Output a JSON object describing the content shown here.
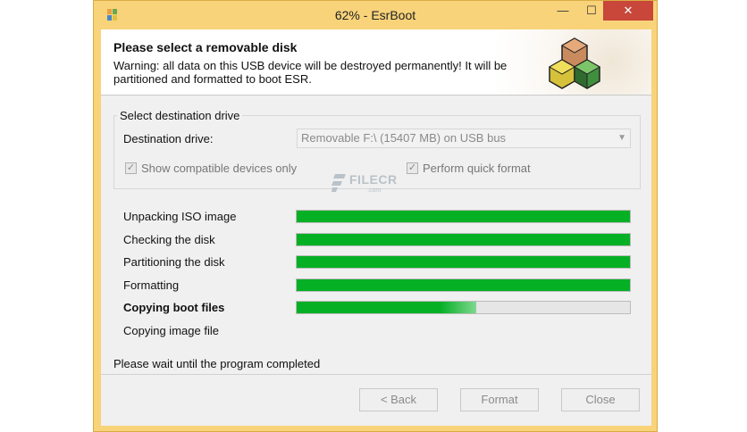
{
  "window": {
    "title": "62% - EsrBoot",
    "minimize_glyph": "—",
    "maximize_glyph": "☐",
    "close_glyph": "✕",
    "close_color": "#c8463a",
    "frame_color": "#f8d37a"
  },
  "header": {
    "title": "Please select a removable disk",
    "warning": "Warning: all data on this USB device will be destroyed permanently! It will be partitioned and formatted to boot ESR."
  },
  "destination": {
    "group_title": "Select destination drive",
    "drive_label": "Destination drive:",
    "drive_value": "Removable  F:\\  (15407 MB)  on USB bus",
    "show_compatible_label": "Show compatible devices only",
    "show_compatible_checked": true,
    "quick_format_label": "Perform quick format",
    "quick_format_checked": true
  },
  "watermark": {
    "text": "FILECR",
    "suffix": ".com"
  },
  "steps": [
    {
      "label": "Unpacking ISO image",
      "progress": 1.0,
      "bold": false
    },
    {
      "label": "Checking the disk",
      "progress": 1.0,
      "bold": false
    },
    {
      "label": "Partitioning the disk",
      "progress": 1.0,
      "bold": false
    },
    {
      "label": "Formatting",
      "progress": 1.0,
      "bold": false
    },
    {
      "label": "Copying boot files",
      "progress": 0.54,
      "bold": true
    },
    {
      "label": "Copying image file",
      "progress": null,
      "bold": false
    }
  ],
  "status_text": "Please wait until the program completed",
  "buttons": {
    "back": "< Back",
    "format": "Format",
    "close": "Close"
  },
  "progress_color": "#06b025"
}
